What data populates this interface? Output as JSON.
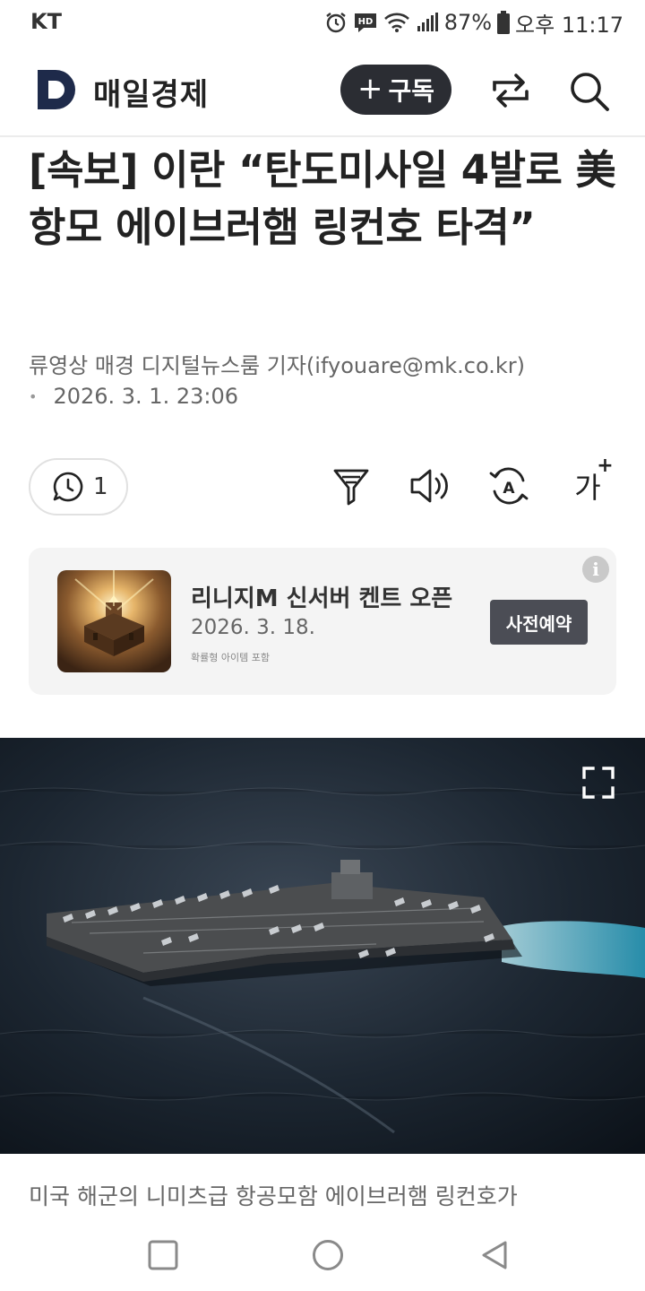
{
  "status_bar": {
    "carrier": "KT",
    "battery": "87%",
    "time": "오후 11:17",
    "icons": [
      "alarm-icon",
      "hd-voice-icon",
      "wifi-icon",
      "signal-icon",
      "battery-icon"
    ]
  },
  "header": {
    "logo_letter": "D",
    "brand": "매일경제",
    "subscribe_label": "구독",
    "subscribe_icon": "plus-icon",
    "share_icon": "share-icon",
    "search_icon": "search-icon"
  },
  "article": {
    "headline": "[속보] 이란 “탄도미사일 4발로 美항모 에이브러햄 링컨호 타격”",
    "byline": "류영상 매경 디지털뉴스룸 기자(ifyouare@mk.co.kr)",
    "date": "2026. 3. 1. 23:06",
    "comment_count": "1",
    "tools": [
      "comment-icon",
      "summary-funnel-icon",
      "speaker-icon",
      "translate-icon",
      "font-size-icon"
    ],
    "font_size_label": "가",
    "image_caption": "미국 해군의 니미츠급 항공모함 에이브러햄 링컨호가"
  },
  "ad": {
    "title": "리니지M 신서버 켄트 오픈",
    "date": "2026. 3. 18.",
    "note": "확률형 아이템 포함",
    "cta": "사전예약",
    "info_symbol": "i"
  },
  "nav": {
    "icons": [
      "recent-apps-icon",
      "home-icon",
      "back-icon"
    ]
  },
  "colors": {
    "accent_dark": "#2b2d33",
    "logo_navy": "#1e2a4a",
    "ad_background": "#f4f4f4",
    "sea": "#1a2430"
  }
}
